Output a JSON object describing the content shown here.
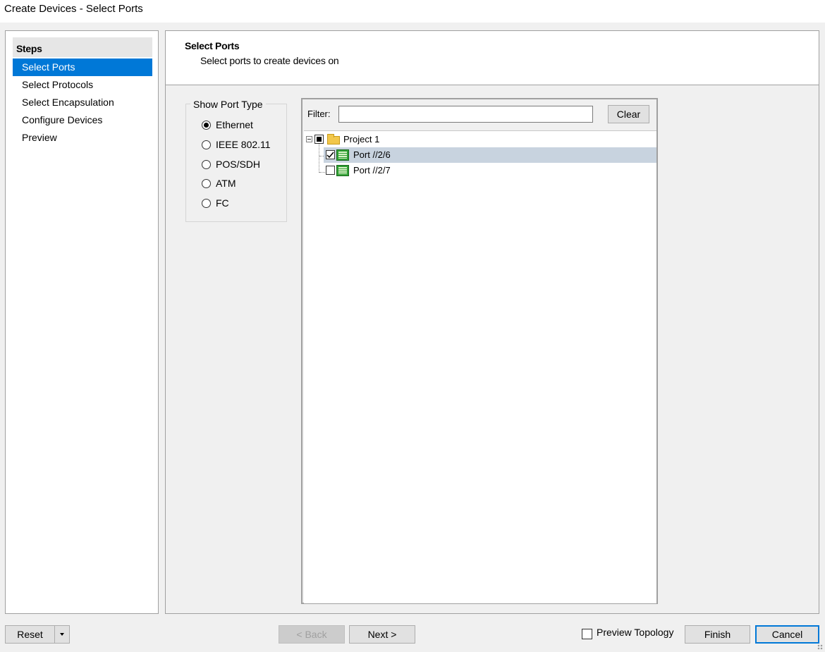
{
  "window": {
    "title": "Create Devices - Select Ports"
  },
  "steps": {
    "header": "Steps",
    "items": [
      {
        "label": "Select Ports",
        "active": true
      },
      {
        "label": "Select Protocols",
        "active": false
      },
      {
        "label": "Select Encapsulation",
        "active": false
      },
      {
        "label": "Configure Devices",
        "active": false
      },
      {
        "label": "Preview",
        "active": false
      }
    ]
  },
  "page": {
    "title": "Select Ports",
    "subtitle": "Select ports to create devices on"
  },
  "port_type": {
    "legend": "Show Port Type",
    "options": [
      {
        "label": "Ethernet",
        "checked": true
      },
      {
        "label": "IEEE 802.11",
        "checked": false
      },
      {
        "label": "POS/SDH",
        "checked": false
      },
      {
        "label": "ATM",
        "checked": false
      },
      {
        "label": "FC",
        "checked": false
      }
    ]
  },
  "filter": {
    "label": "Filter:",
    "value": "",
    "clear_label": "Clear"
  },
  "tree": {
    "project": {
      "label": "Project 1",
      "state": "partial",
      "expanded": true
    },
    "ports": [
      {
        "label": "Port //2/6",
        "checked": true,
        "selected": true
      },
      {
        "label": "Port //2/7",
        "checked": false,
        "selected": false
      }
    ]
  },
  "footer": {
    "reset_label": "Reset",
    "back_label": "< Back",
    "back_enabled": false,
    "next_label": "Next >",
    "preview_topology_label": "Preview Topology",
    "preview_topology_checked": false,
    "finish_label": "Finish",
    "cancel_label": "Cancel"
  },
  "colors": {
    "accent": "#0078d7",
    "selection": "#c8d3df",
    "background": "#f0f0f0"
  }
}
